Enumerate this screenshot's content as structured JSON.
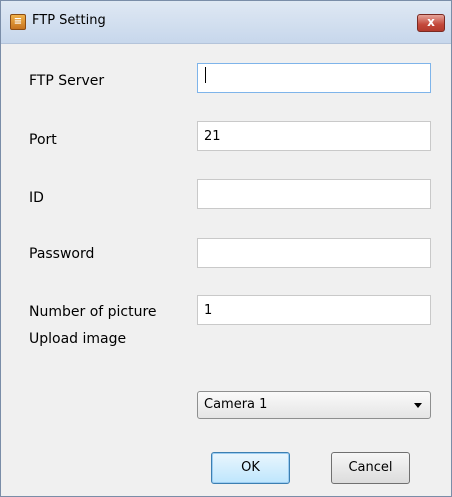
{
  "window": {
    "title": "FTP Setting",
    "close_glyph": "x"
  },
  "form": {
    "ftp_server_label": "FTP Server",
    "ftp_server_value": "",
    "port_label": "Port",
    "port_value": "21",
    "id_label": "ID",
    "id_value": "",
    "password_label": "Password",
    "password_value": "",
    "number_of_picture_label": "Number of picture",
    "number_of_picture_value": "1",
    "upload_image_label": "Upload image",
    "upload_image_selected": "Camera 1"
  },
  "buttons": {
    "ok_label": "OK",
    "cancel_label": "Cancel"
  },
  "icons": {
    "app": "ftp-app-icon",
    "close": "close-icon",
    "dropdown": "chevron-down-icon"
  },
  "colors": {
    "title_bar": "#c7d7ec",
    "close_button": "#c3483a",
    "default_button_border": "#3c7fb1",
    "focus_border": "#7eb4ea"
  }
}
